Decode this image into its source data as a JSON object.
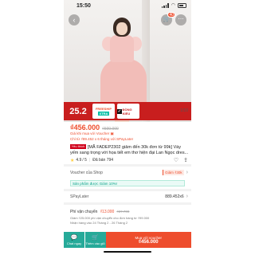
{
  "status_bar": {
    "time": "15:50",
    "signal_icon": "signal-bars-icon",
    "wifi_icon": "wifi-icon",
    "battery_icon": "battery-icon"
  },
  "header": {
    "back_icon": "back-arrow-icon",
    "cart_icon": "cart-icon",
    "cart_badge": "40",
    "more_icon": "more-icon"
  },
  "gallery": {
    "photo_counter": "1/10",
    "promo": {
      "date": "25.2",
      "freeship_top": "FREESHIP",
      "freeship_badge": "XTRA",
      "dong_kieu": "ĐỒNG KIỂU"
    }
  },
  "product": {
    "price": "₫456.000",
    "old_price": "₫599.000",
    "voucher_note": "Giá khi mua với Voucher",
    "spaylater_note": "Chỉ từ ₫89.452 x 6 tháng với SPayLater",
    "mall_tag": "Yêu thích",
    "title": "[MÃ FADEP2302 giảm đến 30k đơn từ 99k] Váy yếm sang trọng với họa tiết em thơ hiện đại Lan Ngọc dres...",
    "rating": "4.9",
    "rating_max": "/ 5",
    "sold": "Đã bán 794"
  },
  "shop_voucher": {
    "label": "Voucher của Shop",
    "chip": "Giảm ₫30k"
  },
  "green_note": {
    "text": "Sản phẩm được Giảm 10%!"
  },
  "spaylater": {
    "label": "SPayLater",
    "value": "889.452x6"
  },
  "shipping": {
    "label": "Phí vận chuyển",
    "price": "₫13.000",
    "old_price": "₫37.700",
    "sub1": "Giảm ₫25.000 phí vận chuyển cho đơn hàng từ ₫99.000",
    "sub2": "Nhận hàng vào 24 Tháng 2 - 26 Tháng 2"
  },
  "bottom_bar": {
    "chat_label": "Chat ngay",
    "cart_label": "Thêm vào giỏ",
    "buy_label": "Mua với voucher",
    "buy_price": "₫456.000"
  },
  "colors": {
    "accent": "#ee4d2d",
    "promo_red": "#c81e1e",
    "teal": "#26aa99"
  }
}
